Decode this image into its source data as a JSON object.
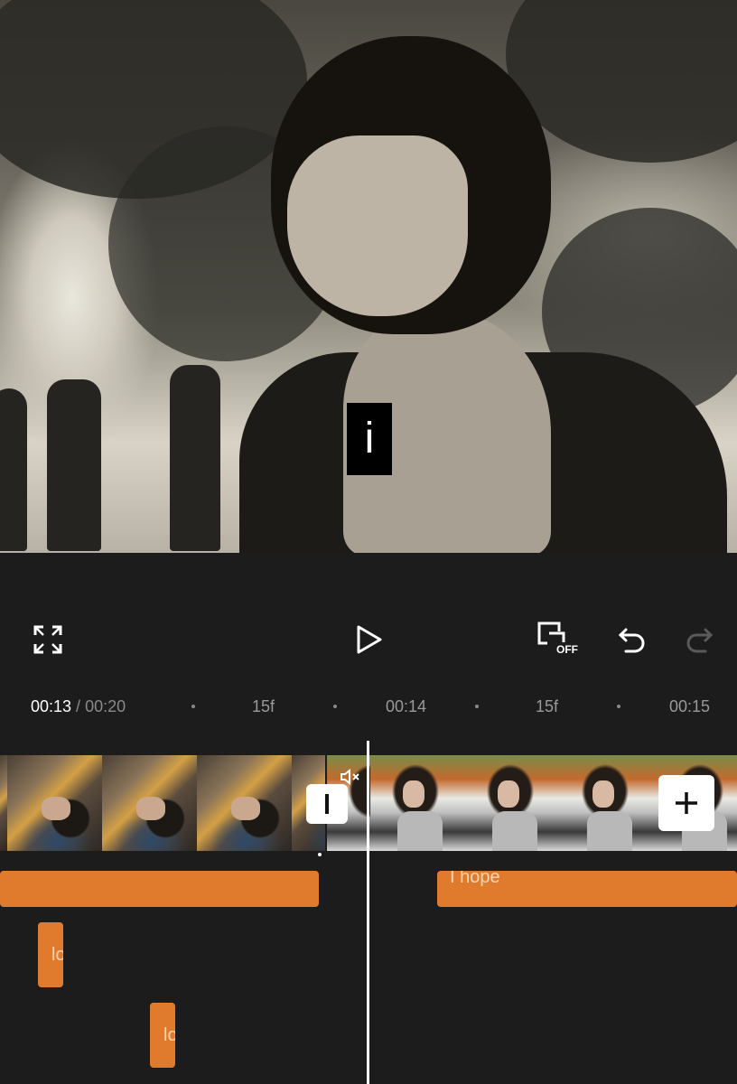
{
  "preview": {
    "caption_text": "i"
  },
  "toolbar": {
    "fullscreen_icon": "fullscreen-icon",
    "play_icon": "play-icon",
    "keyframe_off_icon": "keyframe-off-icon",
    "keyframe_off_label": "OFF",
    "undo_icon": "undo-icon",
    "redo_icon": "redo-icon"
  },
  "ruler": {
    "current_time": "00:13",
    "separator": " / ",
    "total_time": "00:20",
    "marks": [
      "15f",
      "00:14",
      "15f",
      "00:15"
    ]
  },
  "timeline": {
    "transition_label": "I",
    "mute_icon": "mute-icon",
    "add_icon": "plus-icon",
    "text_tracks": [
      {
        "label": ""
      },
      {
        "label": "I hope"
      },
      {
        "label": "lo"
      },
      {
        "label": "lo"
      }
    ]
  },
  "colors": {
    "background": "#1c1c1c",
    "text_track": "#e07b2e",
    "playhead": "#ffffff"
  }
}
